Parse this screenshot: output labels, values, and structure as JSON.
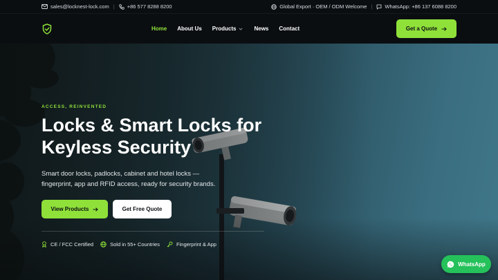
{
  "topbar": {
    "email": "sales@locknest-lock.com",
    "phone": "+86 577 8288 8200",
    "export": "Global Export · OEM / ODM Welcome",
    "whatsapp": "WhatsApp: +86 137 6088 8200",
    "icons": [
      "mail-icon",
      "phone-icon",
      "globe-icon",
      "chat-icon"
    ]
  },
  "header": {
    "logo_icon": "shield-check-icon",
    "nav": [
      "Home",
      "About Us",
      "Products",
      "News",
      "Contact"
    ],
    "active_nav": "Home",
    "cta": "Get a Quote"
  },
  "hero": {
    "eyebrow": "ACCESS, REINVENTED",
    "headline_line1": "Locks & Smart Locks for",
    "headline_line2": "Keyless Security",
    "sub_line1": "Smart door locks, padlocks, cabinet and hotel locks —",
    "sub_line2": "fingerprint, app and RFID access, ready for security brands.",
    "primary_button": "View Products",
    "secondary_button": "Get Free Quote",
    "badges": [
      {
        "icon": "award-icon",
        "label": "CE / FCC Certified"
      },
      {
        "icon": "globe-icon",
        "label": "Sold in 55+ Countries"
      },
      {
        "icon": "key-icon",
        "label": "Fingerprint & App"
      }
    ]
  },
  "whatsapp_button": "WhatsApp",
  "colors": {
    "accent": "#8fe13a",
    "dark": "#0b0e11",
    "whatsapp": "#25c15a"
  }
}
